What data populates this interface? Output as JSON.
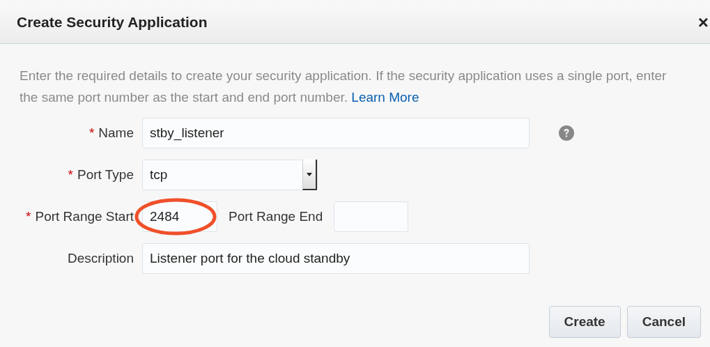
{
  "dialog": {
    "title": "Create Security Application",
    "close": "×"
  },
  "intro": {
    "text": "Enter the required details to create your security application. If the security application uses a single port, enter the same port number as the start and end port number.",
    "link": "Learn More"
  },
  "rows": [
    {
      "kind": "text",
      "label": "Name",
      "required_mark": "*",
      "value": "stby_listener",
      "help": true
    },
    {
      "kind": "select",
      "label": "Port Type",
      "required_mark": "*",
      "value": "tcp"
    },
    {
      "kind": "range",
      "label": "Port Range Start",
      "required_mark": "*",
      "value": "2484",
      "highlighted": true,
      "end_label": "Port Range End",
      "end_value": ""
    },
    {
      "kind": "text",
      "label": "Description",
      "value": "Listener port for the cloud standby",
      "help": false
    }
  ],
  "buttons": [
    "Create",
    "Cancel"
  ]
}
